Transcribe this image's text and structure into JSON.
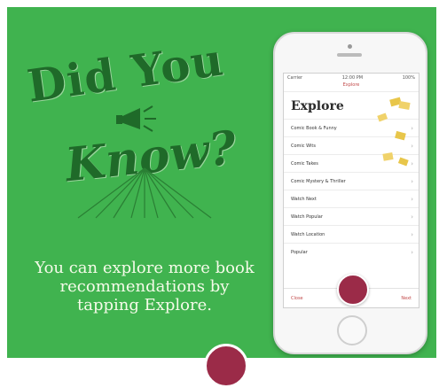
{
  "headline": {
    "line1": "Did You",
    "line2": "Know?"
  },
  "body_text": "You can explore more book recommendations by tapping Explore.",
  "phone": {
    "status_left": "Carrier",
    "status_time": "12:00 PM",
    "status_right": "100%",
    "app_name": "Explore",
    "screen_title": "Explore",
    "list_items": [
      "Comic Book & Funny",
      "Comic Wits",
      "Comic Takes",
      "Comic Mystery & Thriller",
      "Watch Next",
      "Watch Popular",
      "Watch Location",
      "Popular"
    ],
    "tab_left": "Close",
    "tab_right": "Next"
  },
  "colors": {
    "background": "#40b34f",
    "headline": "#1f6a29",
    "body_text": "#f5fbe9",
    "logo": "#9b2b48"
  },
  "icons": [
    "megaphone-icon",
    "chevron-right-icon",
    "app-logo-icon",
    "book-stack-icon"
  ]
}
